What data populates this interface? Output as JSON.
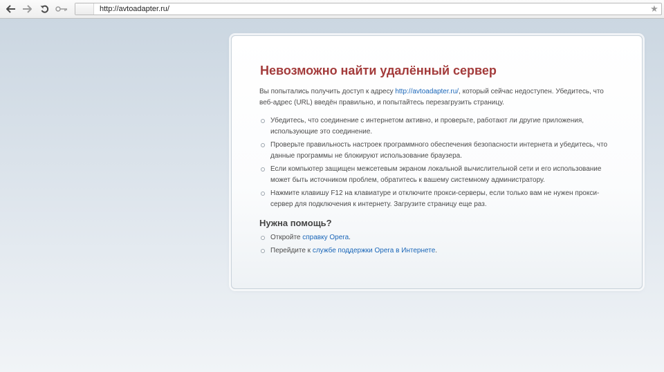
{
  "toolbar": {
    "back_icon": "arrow-left-icon",
    "forward_icon": "arrow-right-icon",
    "reload_icon": "reload-icon",
    "key_icon": "key-icon",
    "address_value": "http://avtoadapter.ru/",
    "bookmark_icon": "star-icon"
  },
  "error": {
    "title": "Невозможно найти удалённый сервер",
    "desc_prefix": "Вы попытались получить доступ к адресу ",
    "desc_link": "http://avtoadapter.ru/",
    "desc_suffix": ", который сейчас недоступен. Убедитесь, что веб-адрес (URL) введён правильно, и попытайтесь перезагрузить страницу.",
    "bullets": [
      "Убедитесь, что соединение с интернетом активно, и проверьте, работают ли другие приложения, использующие это соединение.",
      "Проверьте правильность настроек программного обеспечения безопасности интернета и убедитесь, что данные программы не блокируют использование браузера.",
      "Если компьютер защищен межсетевым экраном локальной вычислительной сети и его использование может быть источником проблем, обратитесь к вашему системному администратору.",
      "Нажмите клавишу F12 на клавиатуре и отключите прокси-серверы, если только вам не нужен прокси-сервер для подключения к интернету. Загрузите страницу еще раз."
    ],
    "help_title": "Нужна помощь?",
    "help": [
      {
        "prefix": "Откройте ",
        "link": "справку Opera",
        "suffix": "."
      },
      {
        "prefix": "Перейдите к ",
        "link": "службе поддержки Opera в Интернете",
        "suffix": "."
      }
    ]
  },
  "colors": {
    "title": "#a33b3b",
    "link": "#1a66b8",
    "body_text": "#4b4b4b"
  }
}
